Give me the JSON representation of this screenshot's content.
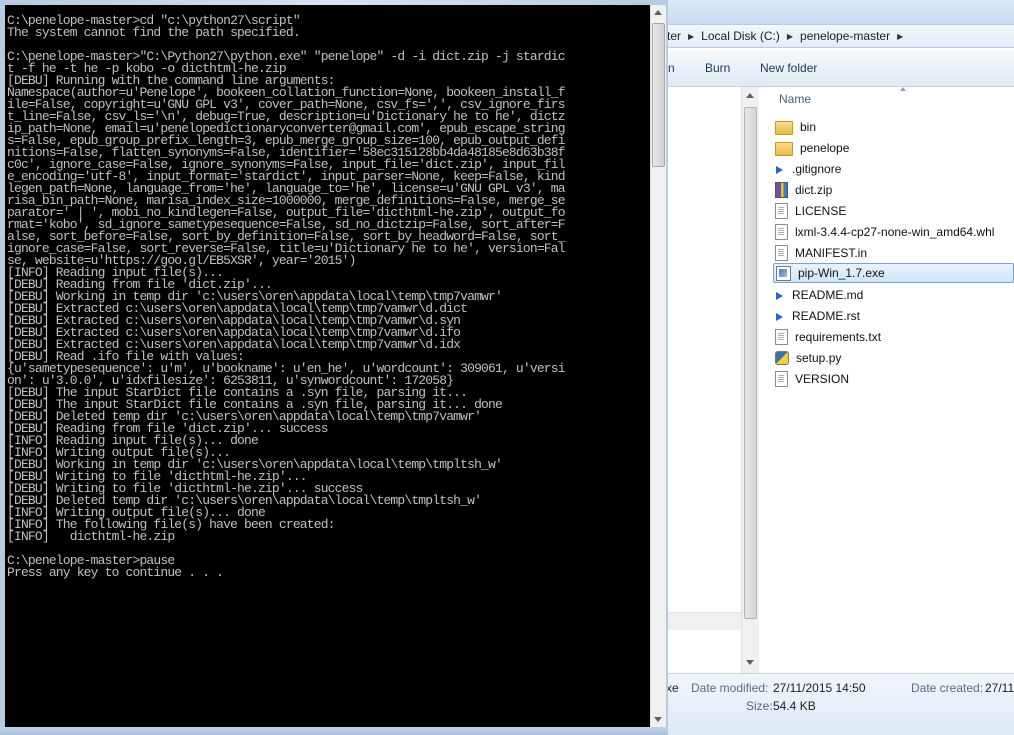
{
  "explorer": {
    "breadcrumb": [
      "ter",
      "Local Disk (C:)",
      "penelope-master"
    ],
    "toolbar": {
      "left": "n",
      "burn": "Burn",
      "new_folder": "New folder"
    },
    "column_name": "Name",
    "files": [
      {
        "name": "bin",
        "icon": "folder-icon"
      },
      {
        "name": "penelope",
        "icon": "folder-icon"
      },
      {
        "name": ".gitignore",
        "icon": "markdown-icon"
      },
      {
        "name": "dict.zip",
        "icon": "zip-icon"
      },
      {
        "name": "LICENSE",
        "icon": "document-icon"
      },
      {
        "name": "lxml-3.4.4-cp27-none-win_amd64.whl",
        "icon": "document-icon"
      },
      {
        "name": "MANIFEST.in",
        "icon": "document-icon"
      },
      {
        "name": "pip-Win_1.7.exe",
        "icon": "exe-icon",
        "selected": true
      },
      {
        "name": "README.md",
        "icon": "markdown-icon"
      },
      {
        "name": "README.rst",
        "icon": "markdown-icon"
      },
      {
        "name": "requirements.txt",
        "icon": "document-icon"
      },
      {
        "name": "setup.py",
        "icon": "python-icon"
      },
      {
        "name": "VERSION",
        "icon": "document-icon"
      }
    ],
    "details": {
      "type_fragment": "xe",
      "date_modified_label": "Date modified:",
      "date_modified": "27/11/2015 14:50",
      "date_created_label": "Date created:",
      "date_created": "27/11",
      "size_label": "Size:",
      "size": "54.4 KB"
    }
  },
  "console": {
    "text": "C:\\penelope-master>cd \"c:\\python27\\script\"\nThe system cannot find the path specified.\n\nC:\\penelope-master>\"C:\\Python27\\python.exe\" \"penelope\" -d -i dict.zip -j stardic\nt -f he -t he -p kobo -o dicthtml-he.zip\n[DEBU] Running with the command line arguments:\nNamespace(author=u'Penelope', bookeen_collation_function=None, bookeen_install_f\nile=False, copyright=u'GNU GPL v3', cover_path=None, csv_fs=',', csv_ignore_firs\nt_line=False, csv_ls='\\n', debug=True, description=u'Dictionary he to he', dictz\nip_path=None, email=u'penelopedictionaryconverter@gmail.com', epub_escape_string\ns=False, epub_group_prefix_length=3, epub_merge_group_size=100, epub_output_defi\nnitions=False, flatten_synonyms=False, identifier='58ec315128bb4da48185e8d63b38f\nc0c', ignore_case=False, ignore_synonyms=False, input_file='dict.zip', input_fil\ne_encoding='utf-8', input_format='stardict', input_parser=None, keep=False, kind\nlegen_path=None, language_from='he', language_to='he', license=u'GNU GPL v3', ma\nrisa_bin_path=None, marisa_index_size=1000000, merge_definitions=False, merge_se\nparator=' | ', mobi_no_kindlegen=False, output_file='dicthtml-he.zip', output_fo\nrmat='kobo', sd_ignore_sametypesequence=False, sd_no_dictzip=False, sort_after=F\nalse, sort_before=False, sort_by_definition=False, sort_by_headword=False, sort_\nignore_case=False, sort_reverse=False, title=u'Dictionary he to he', version=Fal\nse, website=u'https://goo.gl/EB5XSR', year='2015')\n[INFO] Reading input file(s)...\n[DEBU] Reading from file 'dict.zip'...\n[DEBU] Working in temp dir 'c:\\users\\oren\\appdata\\local\\temp\\tmp7vamwr'\n[DEBU] Extracted c:\\users\\oren\\appdata\\local\\temp\\tmp7vamwr\\d.dict\n[DEBU] Extracted c:\\users\\oren\\appdata\\local\\temp\\tmp7vamwr\\d.syn\n[DEBU] Extracted c:\\users\\oren\\appdata\\local\\temp\\tmp7vamwr\\d.ifo\n[DEBU] Extracted c:\\users\\oren\\appdata\\local\\temp\\tmp7vamwr\\d.idx\n[DEBU] Read .ifo file with values:\n{u'sametypesequence': u'm', u'bookname': u'en_he', u'wordcount': 309061, u'versi\non': u'3.0.0', u'idxfilesize': 6253811, u'synwordcount': 172058}\n[DEBU] The input StarDict file contains a .syn file, parsing it...\n[DEBU] The input StarDict file contains a .syn file, parsing it... done\n[DEBU] Deleted temp dir 'c:\\users\\oren\\appdata\\local\\temp\\tmp7vamwr'\n[DEBU] Reading from file 'dict.zip'... success\n[INFO] Reading input file(s)... done\n[INFO] Writing output file(s)...\n[DEBU] Working in temp dir 'c:\\users\\oren\\appdata\\local\\temp\\tmpltsh_w'\n[DEBU] Writing to file 'dicthtml-he.zip'...\n[DEBU] Writing to file 'dicthtml-he.zip'... success\n[DEBU] Deleted temp dir 'c:\\users\\oren\\appdata\\local\\temp\\tmpltsh_w'\n[INFO] Writing output file(s)... done\n[INFO] The following file(s) have been created:\n[INFO]   dicthtml-he.zip\n\nC:\\penelope-master>pause\nPress any key to continue . . ."
  }
}
